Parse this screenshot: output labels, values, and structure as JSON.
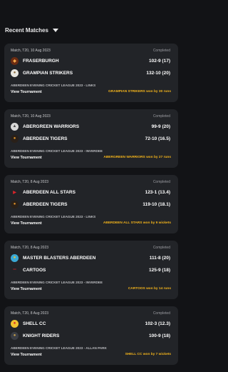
{
  "header": {
    "title": "Recent Matches"
  },
  "matches": [
    {
      "meta": "Match, T20, 10 Aug 2023",
      "status": "Completed",
      "team1": {
        "name": "FRASERBURGH",
        "score": "102-9 (17)",
        "logo_bg": "#6b2c12",
        "logo_fg": "#f4a74a",
        "logo_char": "◆",
        "logo_icon": "fraserburgh-logo"
      },
      "team2": {
        "name": "GRAMPIAN STRIKERS",
        "score": "132-10 (20)",
        "logo_bg": "#e8e6df",
        "logo_fg": "#8a6a3a",
        "logo_char": "●",
        "logo_icon": "grampian-strikers-logo"
      },
      "league": "ABERDEEN EVENING CRICKET LEAGUE 2023 - LINKS",
      "view_label": "View Tournament",
      "result": "GRAMPIAN STRIKERS won by 30 runs"
    },
    {
      "meta": "Match, T20, 10 Aug 2023",
      "status": "Completed",
      "team1": {
        "name": "ABERGREEN WARRIORS",
        "score": "99-9 (20)",
        "logo_bg": "#d8d8d8",
        "logo_fg": "#4a4a4a",
        "logo_char": "▲",
        "logo_icon": "abergreen-warriors-logo"
      },
      "team2": {
        "name": "ABERDEEN TIGERS",
        "score": "72-10 (16.5)",
        "logo_bg": "#2a2018",
        "logo_fg": "#e0932a",
        "logo_char": "●",
        "logo_icon": "aberdeen-tigers-logo"
      },
      "league": "ABERDEEN EVENING CRICKET LEAGUE 2023 - INVERDEE",
      "view_label": "View Tournament",
      "result": "ABERGREEN WARRIORS won by 27 runs"
    },
    {
      "meta": "Match, T20, 8 Aug 2023",
      "status": "Completed",
      "team1": {
        "name": "ABERDEEN ALL STARS",
        "score": "123-1 (13.4)",
        "logo_bg": "#222428",
        "logo_fg": "#d8242a",
        "logo_char": "▶",
        "logo_icon": "aberdeen-all-stars-logo"
      },
      "team2": {
        "name": "ABERDEEN TIGERS",
        "score": "119-10 (18.1)",
        "logo_bg": "#2a2018",
        "logo_fg": "#e0932a",
        "logo_char": "●",
        "logo_icon": "aberdeen-tigers-logo"
      },
      "league": "ABERDEEN EVENING CRICKET LEAGUE 2023 - LINKS",
      "view_label": "View Tournament",
      "result": "ABERDEEN ALL STARS won by 9 wickets"
    },
    {
      "meta": "Match, T20, 8 Aug 2023",
      "status": "Completed",
      "team1": {
        "name": "MASTER BLASTERS ABERDEEN",
        "score": "111-8 (20)",
        "logo_bg": "#3aa9d6",
        "logo_fg": "#f2c230",
        "logo_char": "●",
        "logo_icon": "master-blasters-logo"
      },
      "team2": {
        "name": "CARTOOS",
        "score": "125-9 (18)",
        "logo_bg": "#222428",
        "logo_fg": "#d8242a",
        "logo_char": "═",
        "logo_icon": "cartoos-logo"
      },
      "league": "ABERDEEN EVENING CRICKET LEAGUE 2023 - INVERDEE",
      "view_label": "View Tournament",
      "result": "CARTOOS won by 14 runs"
    },
    {
      "meta": "Match, T20, 8 Aug 2023",
      "status": "Completed",
      "team1": {
        "name": "SHELL CC",
        "score": "102-3 (12.3)",
        "logo_bg": "#f2c230",
        "logo_fg": "#d8242a",
        "logo_char": "●",
        "logo_icon": "shell-cc-logo"
      },
      "team2": {
        "name": "KNIGHT RIDERS",
        "score": "100-9 (18)",
        "logo_bg": "#3a3d44",
        "logo_fg": "#c9a24a",
        "logo_char": "●",
        "logo_icon": "knight-riders-logo"
      },
      "league": "ABERDEEN EVENING CRICKET LEAGUE 2023 - ALLAN PARK",
      "view_label": "View Tournament",
      "result": "SHELL CC won by 7 wickets"
    }
  ]
}
